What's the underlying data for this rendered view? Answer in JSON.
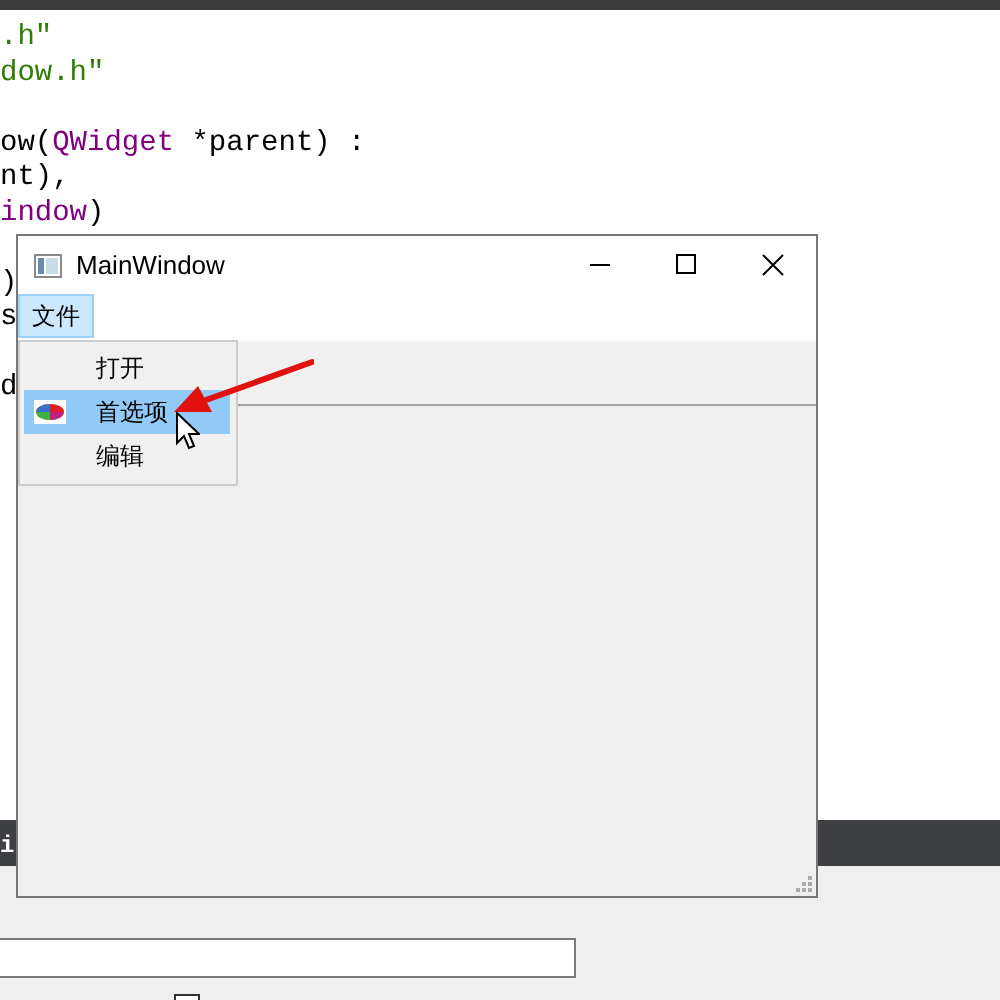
{
  "editor": {
    "blocks": [
      [
        [
          {
            "kind": "string",
            "text": ".h\""
          }
        ],
        [
          {
            "kind": "string",
            "text": "dow.h\""
          }
        ]
      ],
      [
        [
          {
            "kind": "plain",
            "text": "ow("
          },
          {
            "kind": "type",
            "text": "QWidget"
          },
          {
            "kind": "plain",
            "text": " *parent) :"
          }
        ],
        [
          {
            "kind": "plain",
            "text": "nt),"
          }
        ],
        [
          {
            "kind": "type",
            "text": "indow"
          },
          {
            "kind": "plain",
            "text": ")"
          }
        ]
      ],
      [
        [
          {
            "kind": "plain",
            "text": ")"
          }
        ],
        [
          {
            "kind": "plain",
            "text": "s"
          }
        ]
      ],
      [
        [
          {
            "kind": "plain",
            "text": "d"
          }
        ]
      ]
    ]
  },
  "output_bar": {
    "text": "i"
  },
  "bottom_panel": {
    "checkbox": {
      "checked": false
    }
  },
  "window": {
    "title": "MainWindow",
    "menubar": [
      {
        "label": "文件",
        "selected": true
      }
    ],
    "menu": {
      "items": [
        {
          "label": "打开",
          "selected": false,
          "has_icon": false
        },
        {
          "label": "首选项",
          "selected": true,
          "has_icon": true
        },
        {
          "label": "编辑",
          "selected": false,
          "has_icon": false
        }
      ]
    }
  }
}
